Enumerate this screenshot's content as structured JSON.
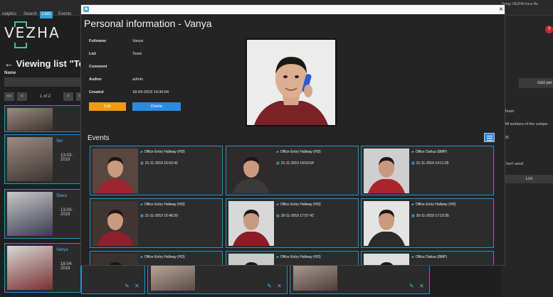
{
  "background": {
    "tabs": [
      "nalytics",
      "Search",
      "Lists",
      "Events"
    ],
    "logo": "VEZHA",
    "viewing_title": "← Viewing list \"Team",
    "name_label": "Name",
    "pager_text": "1 of 2",
    "pager_buttons": [
      "<<",
      "<",
      ">",
      ">>"
    ],
    "cards": [
      {
        "name": "",
        "date": ""
      },
      {
        "name": "Ser",
        "date": "13-03-2019"
      },
      {
        "name": "Slava",
        "date": "13-03-2019"
      },
      {
        "name": "Vanya",
        "date": "18-04-2019"
      }
    ],
    "right_tabs": "Setup    VEZHA Face Re",
    "badge": "?",
    "add_button": "Add per",
    "right_texts": [
      "Team",
      "All workers of the compa",
      "25",
      "Don't send"
    ],
    "list_button": "List"
  },
  "modal": {
    "title": "Personal information - Vanya",
    "close": "×",
    "fields": [
      {
        "label": "Fullname",
        "value": "Vanya"
      },
      {
        "label": "List",
        "value": "Team"
      },
      {
        "label": "Comment",
        "value": ""
      },
      {
        "label": "Author",
        "value": "admin"
      },
      {
        "label": "Created",
        "value": "18-04-2019 14:30:04"
      }
    ],
    "edit_label": "Edit",
    "delete_label": "Delete",
    "events_title": "Events",
    "events": [
      {
        "camera": "Office Entry Hallway (HD)",
        "datetime": "21-11-2019 15:53:42"
      },
      {
        "camera": "Office Entry Hallway (HD)",
        "datetime": "21-11-2019 14:53:54"
      },
      {
        "camera": "Office Dahua (8MP)",
        "datetime": "21-11-2019 14:11:25"
      },
      {
        "camera": "Office Entry Hallway (HD)",
        "datetime": "21-11-2019 15:48:20"
      },
      {
        "camera": "Office Entry Hallway (HD)",
        "datetime": "20-11-2019 17:57:42"
      },
      {
        "camera": "Office Entry Hallway (HD)",
        "datetime": "20-11-2019 17:10:35"
      },
      {
        "camera": "Office Entry Hallway (HD)",
        "datetime": ""
      },
      {
        "camera": "Office Entry Hallway (HD)",
        "datetime": ""
      },
      {
        "camera": "Office Dahua (8MP)",
        "datetime": ""
      }
    ]
  }
}
